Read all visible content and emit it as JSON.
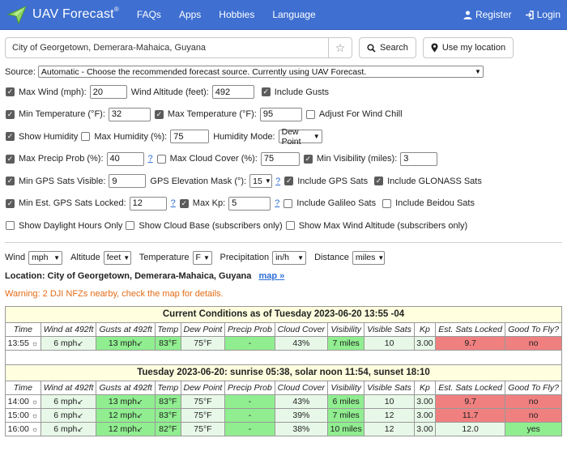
{
  "navbar": {
    "brand": "UAV Forecast",
    "brand_mark": "®",
    "links": [
      "FAQs",
      "Apps",
      "Hobbies",
      "Language"
    ],
    "register": "Register",
    "login": "Login"
  },
  "search": {
    "location_value": "City of Georgetown, Demerara-Mahaica, Guyana",
    "search_label": "Search",
    "use_location_label": "Use my location"
  },
  "source": {
    "label": "Source:",
    "selected": "Automatic - Choose the recommended forecast source. Currently using UAV Forecast."
  },
  "options": {
    "max_wind_label": "Max Wind (mph):",
    "max_wind": "20",
    "wind_alt_label": "Wind Altitude (feet):",
    "wind_alt": "492",
    "include_gusts": "Include Gusts",
    "min_temp_label": "Min Temperature (°F):",
    "min_temp": "32",
    "max_temp_label": "Max Temperature (°F):",
    "max_temp": "95",
    "wind_chill": "Adjust For Wind Chill",
    "show_humidity": "Show Humidity",
    "max_humidity_label": "Max Humidity (%):",
    "max_humidity": "75",
    "humidity_mode_label": "Humidity Mode:",
    "humidity_mode": "Dew Point",
    "max_precip_label": "Max Precip Prob (%):",
    "max_precip": "40",
    "max_cloud_label": "Max Cloud Cover (%):",
    "max_cloud": "75",
    "min_vis_label": "Min Visibility (miles):",
    "min_vis": "3",
    "min_gps_label": "Min GPS Sats Visible:",
    "min_gps": "9",
    "gps_mask_label": "GPS Elevation Mask (°):",
    "gps_mask": "15",
    "incl_gps": "Include GPS Sats",
    "incl_glonass": "Include GLONASS Sats",
    "min_locked_label": "Min Est. GPS Sats Locked:",
    "min_locked": "12",
    "max_kp_label": "Max Kp:",
    "max_kp": "5",
    "incl_galileo": "Include Galileo Sats",
    "incl_beidou": "Include Beidou Sats",
    "daylight": "Show Daylight Hours Only",
    "cloud_base": "Show Cloud Base (subscribers only)",
    "max_wind_alt": "Show Max Wind Altitude (subscribers only)",
    "help": "?"
  },
  "units": {
    "wind_label": "Wind",
    "wind": "mph",
    "altitude_label": "Altitude",
    "altitude": "feet",
    "temperature_label": "Temperature",
    "temperature": "F",
    "precip_label": "Precipitation",
    "precip": "in/h",
    "distance_label": "Distance",
    "distance": "miles"
  },
  "location_line": {
    "text": "Location: City of Georgetown, Demerara-Mahaica, Guyana",
    "map_link": "map »"
  },
  "warning": "Warning: 2 DJI NFZs nearby, check the map for details.",
  "table": {
    "current_title": "Current Conditions as of Tuesday 2023-06-20 13:55 -04",
    "day_title": "Tuesday 2023-06-20: sunrise 05:38, solar noon 11:54, sunset 18:10",
    "headers": [
      "Time",
      "Wind at 492ft",
      "Gusts at 492ft",
      "Temp",
      "Dew Point",
      "Precip Prob",
      "Cloud Cover",
      "Visibility",
      "Visible Sats",
      "Kp",
      "Est. Sats Locked",
      "Good To Fly?"
    ],
    "current_row": [
      "13:55",
      "6 mph",
      "13 mph",
      "83°F",
      "75°F",
      "-",
      "43%",
      "7 miles",
      "10",
      "3.00",
      "9.7",
      "no"
    ],
    "rows": [
      [
        "14:00",
        "6 mph",
        "13 mph",
        "83°F",
        "75°F",
        "-",
        "43%",
        "6 miles",
        "10",
        "3.00",
        "9.7",
        "no"
      ],
      [
        "15:00",
        "6 mph",
        "12 mph",
        "83°F",
        "75°F",
        "-",
        "39%",
        "7 miles",
        "12",
        "3.00",
        "11.7",
        "no"
      ],
      [
        "16:00",
        "6 mph",
        "12 mph",
        "82°F",
        "75°F",
        "-",
        "38%",
        "10 miles",
        "12",
        "3.00",
        "12.0",
        "yes"
      ]
    ]
  },
  "colors": {
    "navbar": "#3e6fd1",
    "good": "#90ee90",
    "light_good": "#e8f8e8",
    "bad": "#f08080",
    "title_bg": "#ffffdf",
    "warning": "#e26b16"
  }
}
